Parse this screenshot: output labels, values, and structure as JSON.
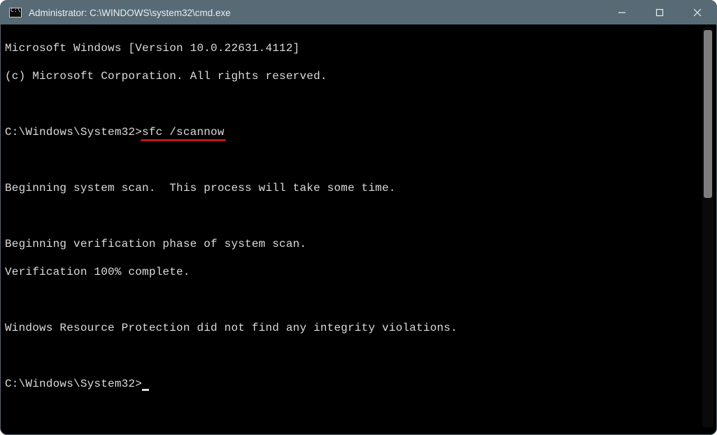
{
  "window": {
    "title": "Administrator: C:\\WINDOWS\\system32\\cmd.exe"
  },
  "terminal": {
    "lines": {
      "l0": "Microsoft Windows [Version 10.0.22631.4112]",
      "l1": "(c) Microsoft Corporation. All rights reserved.",
      "prompt1_path": "C:\\Windows\\System32>",
      "prompt1_cmd": "sfc /scannow",
      "l3": "Beginning system scan.  This process will take some time.",
      "l4": "Beginning verification phase of system scan.",
      "l5": "Verification 100% complete.",
      "l6": "Windows Resource Protection did not find any integrity violations.",
      "prompt2_path": "C:\\Windows\\System32>"
    }
  }
}
